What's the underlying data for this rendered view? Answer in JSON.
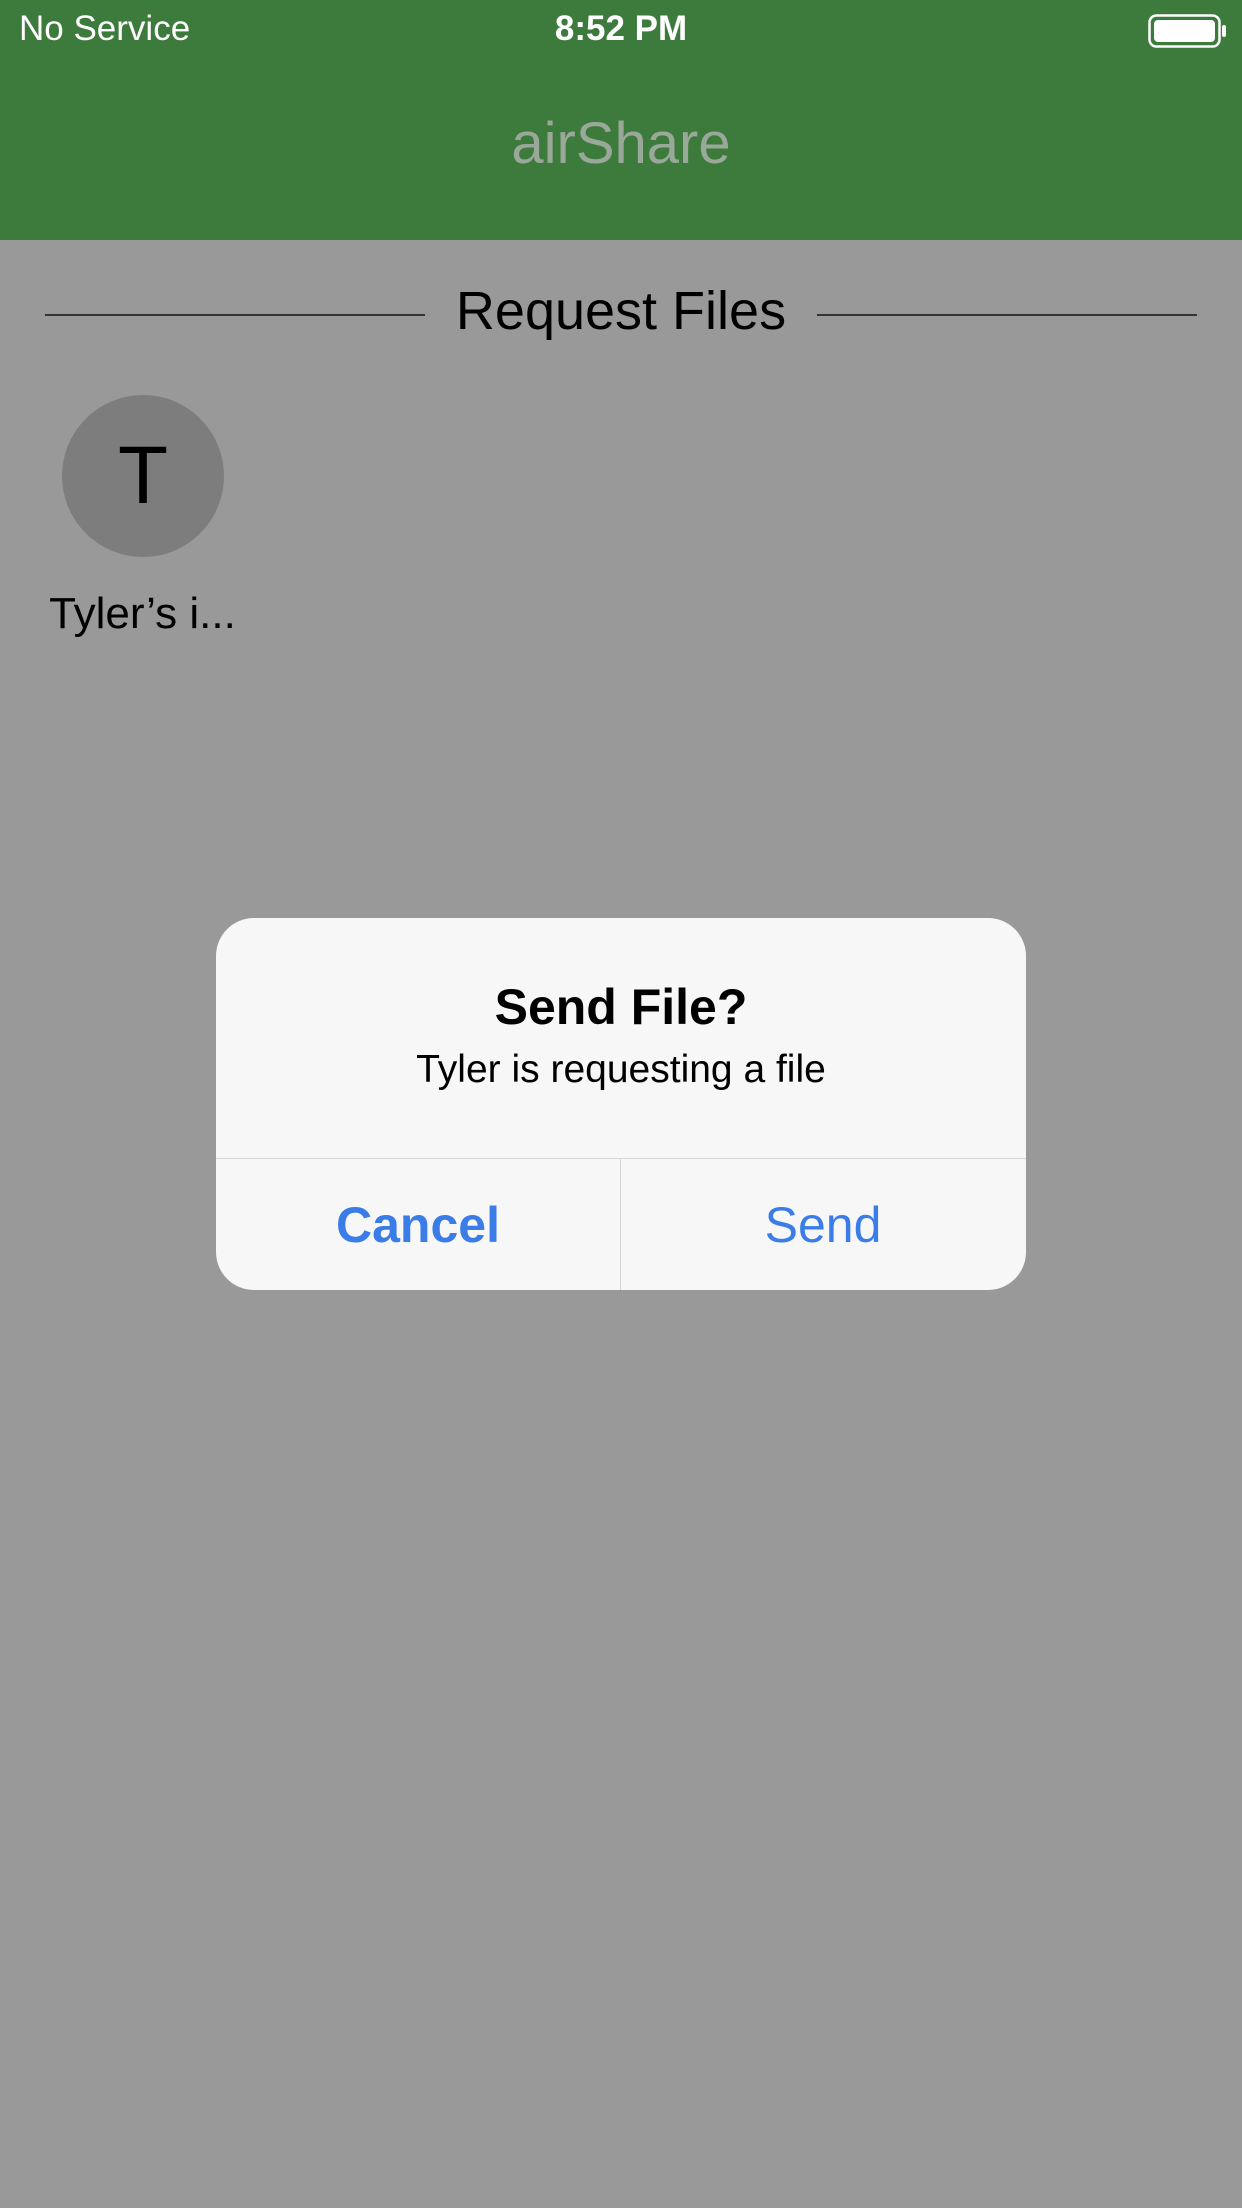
{
  "status_bar": {
    "carrier": "No Service",
    "time": "8:52 PM",
    "battery_icon": "battery-full-icon"
  },
  "nav_bar": {
    "title": "airShare",
    "background_color": "#3d7b3d"
  },
  "section": {
    "title": "Request Files"
  },
  "peers": [
    {
      "initial": "T",
      "name": "Tyler’s i..."
    }
  ],
  "alert": {
    "title": "Send File?",
    "message": "Tyler is requesting a file",
    "cancel_label": "Cancel",
    "send_label": "Send",
    "button_color": "#3a7ce8"
  }
}
